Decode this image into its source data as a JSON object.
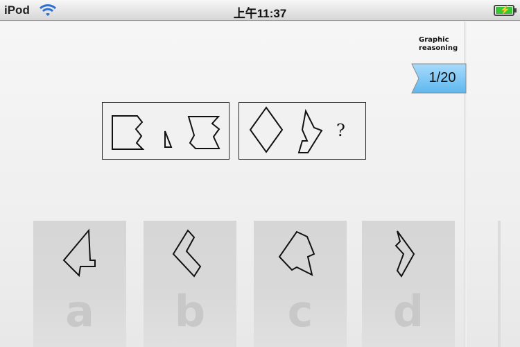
{
  "status_bar": {
    "carrier": "iPod",
    "time": "上午11:37"
  },
  "badge": {
    "title_line1": "Graphic",
    "title_line2": "reasoning",
    "progress": "1/20",
    "ribbon_color": "#7cc6f2"
  },
  "question": {
    "unknown_mark": "?"
  },
  "options": [
    {
      "letter": "a"
    },
    {
      "letter": "b"
    },
    {
      "letter": "c"
    },
    {
      "letter": "d"
    }
  ]
}
